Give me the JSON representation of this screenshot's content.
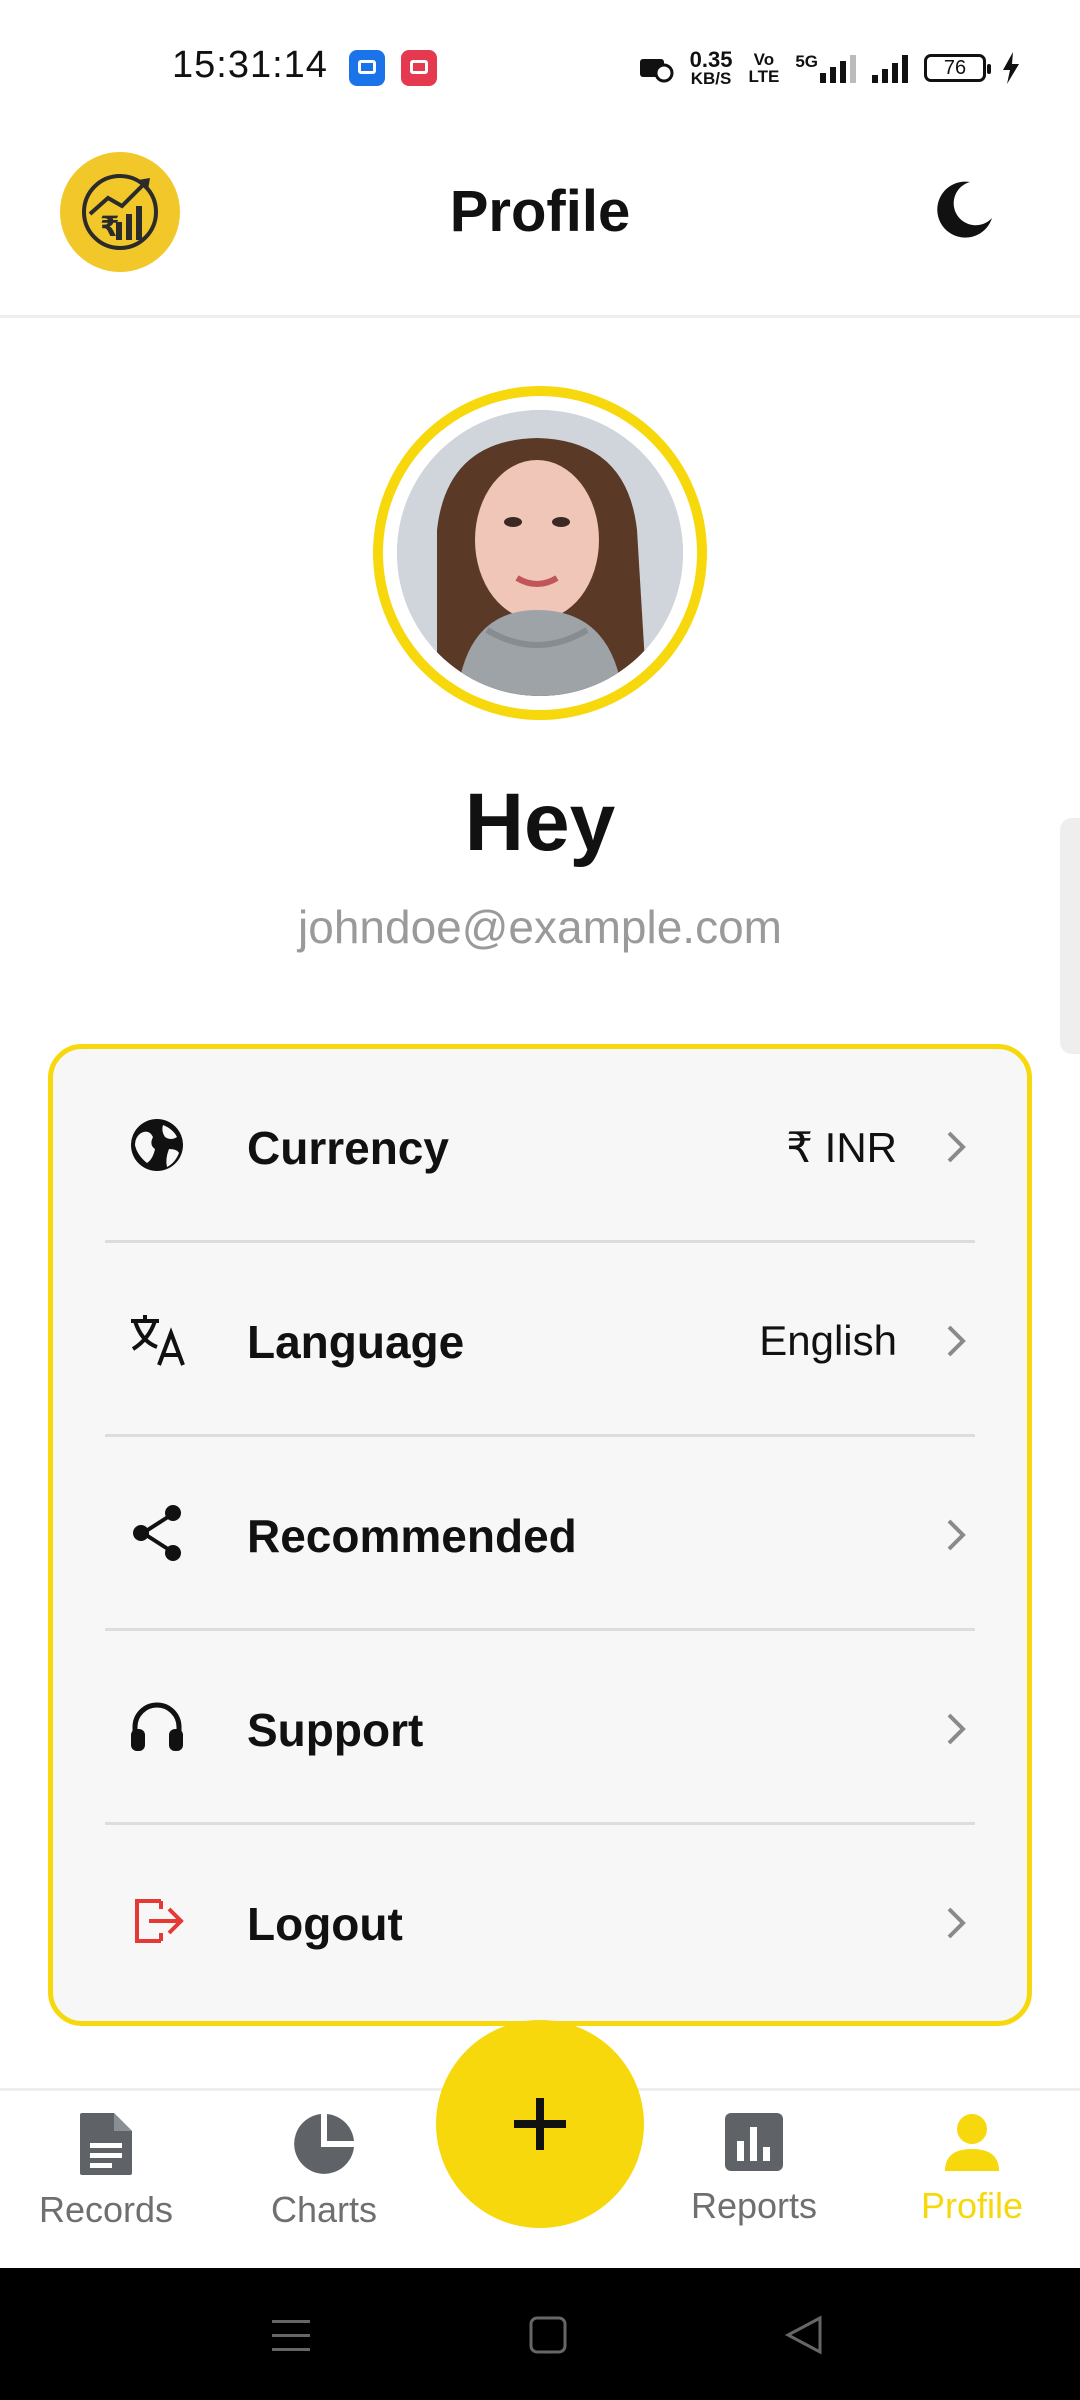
{
  "status_bar": {
    "time": "15:31:14",
    "net_speed_value": "0.35",
    "net_speed_unit": "KB/S",
    "volte_top": "Vo",
    "volte_bottom": "LTE",
    "network_5g": "5G",
    "battery_level": "76",
    "icons": [
      "blue-notification-icon",
      "screen-record-icon",
      "data-saver-icon",
      "signal-icon",
      "charging-icon"
    ]
  },
  "header": {
    "title": "Profile",
    "logo_icon": "rupee-growth-chart-logo",
    "theme_icon": "moon-icon"
  },
  "profile": {
    "greeting": "Hey",
    "email": "johndoe@example.com"
  },
  "settings": {
    "items": [
      {
        "label": "Currency",
        "value": "₹ INR",
        "icon": "globe-icon"
      },
      {
        "label": "Language",
        "value": "English",
        "icon": "translate-icon"
      },
      {
        "label": "Recommended",
        "value": "",
        "icon": "share-icon"
      },
      {
        "label": "Support",
        "value": "",
        "icon": "headphones-icon"
      },
      {
        "label": "Logout",
        "value": "",
        "icon": "logout-icon"
      }
    ]
  },
  "bottom_nav": {
    "items": [
      {
        "label": "Records",
        "icon": "document-icon"
      },
      {
        "label": "Charts",
        "icon": "pie-chart-icon"
      },
      {
        "label": "Reports",
        "icon": "bar-chart-icon"
      },
      {
        "label": "Profile",
        "icon": "person-icon",
        "active": true
      }
    ],
    "fab_icon": "plus-icon"
  },
  "colors": {
    "accent": "#f6d80c",
    "logo": "#f2c72a",
    "logout": "#e53935",
    "muted": "#6f6f6f",
    "email": "#9a9a9a"
  }
}
